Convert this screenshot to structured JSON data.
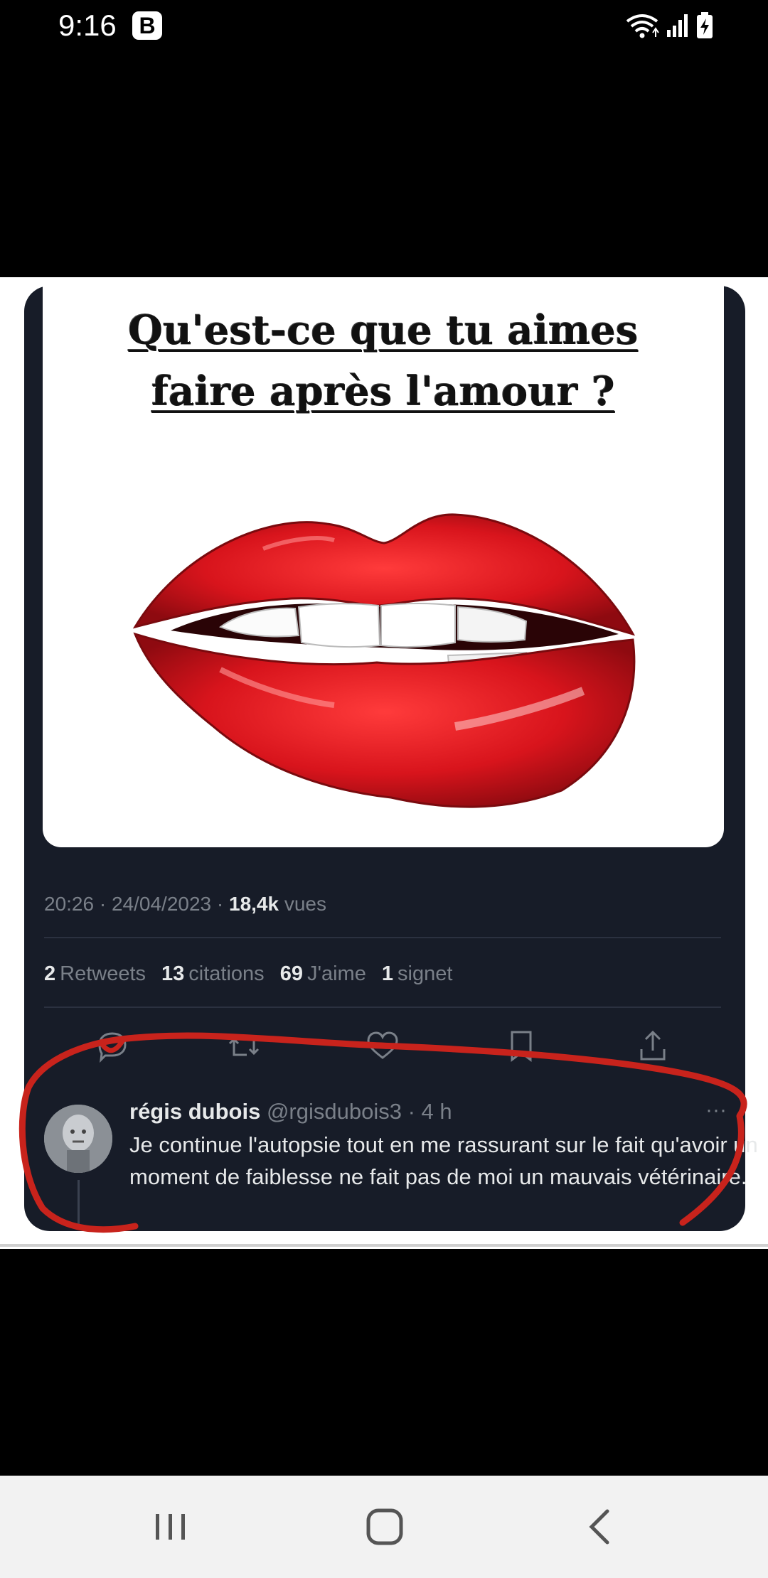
{
  "status_bar": {
    "time": "9:16",
    "badge": "B",
    "icons": [
      "wifi-icon",
      "signal-icon",
      "battery-charging-icon"
    ]
  },
  "meme": {
    "caption_line1": "Qu'est-ce que tu aimes",
    "caption_line2": "faire après l'amour ?",
    "image": "lips-biting-illustration"
  },
  "tweet": {
    "time": "20:26",
    "date": "24/04/2023",
    "views_count": "18,4k",
    "views_label": "vues",
    "stats": [
      {
        "num": "2",
        "label": "Retweets"
      },
      {
        "num": "13",
        "label": "citations"
      },
      {
        "num": "69",
        "label": "J'aime"
      },
      {
        "num": "1",
        "label": "signet"
      }
    ],
    "actions": [
      "reply-icon",
      "retweet-icon",
      "like-icon",
      "bookmark-icon",
      "share-icon"
    ]
  },
  "reply": {
    "name": "régis dubois",
    "handle": "@rgisdubois3",
    "time": "4 h",
    "more": "···",
    "text": "Je continue l'autopsie tout en me rassurant sur le fait qu'avoir un moment de faiblesse ne fait pas de moi un mauvais vétérinaire."
  },
  "colors": {
    "card_bg": "#171c28",
    "annotation_red": "#c8231c",
    "lips_red": "#d8141c"
  },
  "nav_bar": {
    "buttons": [
      "recents-icon",
      "home-icon",
      "back-icon"
    ]
  }
}
